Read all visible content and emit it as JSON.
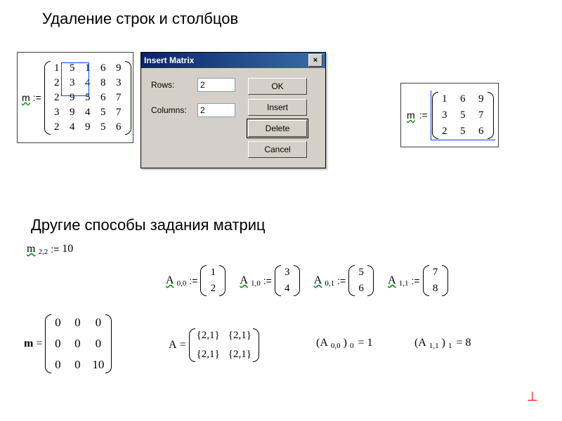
{
  "headings": {
    "top": "Удаление строк и столбцов",
    "middle": "Другие способы задания матриц"
  },
  "matrix1": {
    "var": "m",
    "op": ":=",
    "rows": [
      [
        "1",
        "5",
        "1",
        "6",
        "9"
      ],
      [
        "2",
        "3",
        "4",
        "8",
        "3"
      ],
      [
        "2",
        "9",
        "5",
        "6",
        "7"
      ],
      [
        "3",
        "9",
        "4",
        "5",
        "7"
      ],
      [
        "2",
        "4",
        "9",
        "5",
        "6"
      ]
    ]
  },
  "dialog": {
    "title": "Insert Matrix",
    "rows_label": "Rows:",
    "rows_value": "2",
    "cols_label": "Columns:",
    "cols_value": "2",
    "buttons": {
      "ok": "OK",
      "insert": "Insert",
      "delete": "Delete",
      "cancel": "Cancel"
    },
    "close": "×"
  },
  "matrix2": {
    "var": "m",
    "op": ":=",
    "rows": [
      [
        "1",
        "6",
        "9"
      ],
      [
        "3",
        "5",
        "7"
      ],
      [
        "2",
        "5",
        "6"
      ]
    ]
  },
  "other": {
    "m22": {
      "var": "m",
      "sub": "2,2",
      "op": ":=",
      "val": "10"
    },
    "assignA": [
      {
        "var": "A",
        "sub": "0,0",
        "op": ":=",
        "col": [
          "1",
          "2"
        ]
      },
      {
        "var": "A",
        "sub": "1,0",
        "op": ":=",
        "col": [
          "3",
          "4"
        ]
      },
      {
        "var": "A",
        "sub": "0,1",
        "op": ":=",
        "col": [
          "5",
          "6"
        ]
      },
      {
        "var": "A",
        "sub": "1,1",
        "op": ":=",
        "col": [
          "7",
          "8"
        ]
      }
    ],
    "mresult": {
      "var": "m",
      "op": "=",
      "rows": [
        [
          "0",
          "0",
          "0"
        ],
        [
          "0",
          "0",
          "0"
        ],
        [
          "0",
          "0",
          "10"
        ]
      ]
    },
    "Aresult": {
      "var": "A",
      "op": "=",
      "rows": [
        [
          "{2,1}",
          "{2,1}"
        ],
        [
          "{2,1}",
          "{2,1}"
        ]
      ]
    },
    "elem1": {
      "lhs": "(A",
      "sub1": "0,0",
      "mid": ")",
      "sub2": "0",
      "eq": "= 1"
    },
    "elem2": {
      "lhs": "(A",
      "sub1": "1,1",
      "mid": ")",
      "sub2": "1",
      "eq": "= 8"
    }
  }
}
